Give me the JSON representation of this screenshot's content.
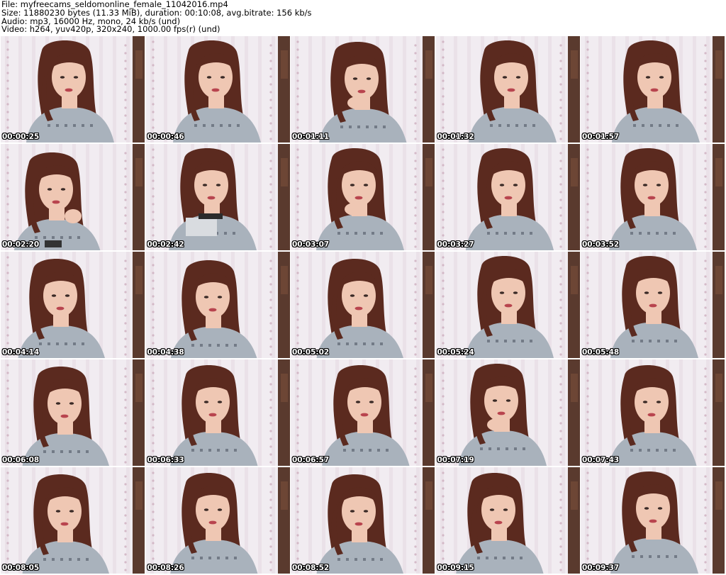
{
  "header": {
    "file_line": "File: myfreecams_seldomonline_female_11042016.mp4",
    "size_line": "Size: 11880230 bytes (11.33 MiB), duration: 00:10:08, avg.bitrate: 156 kb/s",
    "audio_line": "Audio: mp3, 16000 Hz, mono, 24 kb/s (und)",
    "video_line": "Video: h264, yuv420p, 320x240, 1000.00 fps(r) (und)"
  },
  "thumbnails": [
    {
      "timestamp": "00:00:25"
    },
    {
      "timestamp": "00:00:46"
    },
    {
      "timestamp": "00:01:11"
    },
    {
      "timestamp": "00:01:32"
    },
    {
      "timestamp": "00:01:57"
    },
    {
      "timestamp": "00:02:20"
    },
    {
      "timestamp": "00:02:42"
    },
    {
      "timestamp": "00:03:07"
    },
    {
      "timestamp": "00:03:27"
    },
    {
      "timestamp": "00:03:52"
    },
    {
      "timestamp": "00:04:14"
    },
    {
      "timestamp": "00:04:38"
    },
    {
      "timestamp": "00:05:02"
    },
    {
      "timestamp": "00:05:24"
    },
    {
      "timestamp": "00:05:48"
    },
    {
      "timestamp": "00:06:08"
    },
    {
      "timestamp": "00:06:33"
    },
    {
      "timestamp": "00:06:57"
    },
    {
      "timestamp": "00:07:19"
    },
    {
      "timestamp": "00:07:43"
    },
    {
      "timestamp": "00:08:05"
    },
    {
      "timestamp": "00:08:26"
    },
    {
      "timestamp": "00:08:52"
    },
    {
      "timestamp": "00:09:15"
    },
    {
      "timestamp": "00:09:37"
    }
  ],
  "colors": {
    "curtain": "#f1ecf1",
    "curtain_pattern": "#c9a6b8",
    "wall_dark": "#5a3a2e",
    "hair": "#5b2a1f",
    "skin": "#efc7b3",
    "sweater": "#a9b2bc",
    "lips": "#b8444e"
  }
}
